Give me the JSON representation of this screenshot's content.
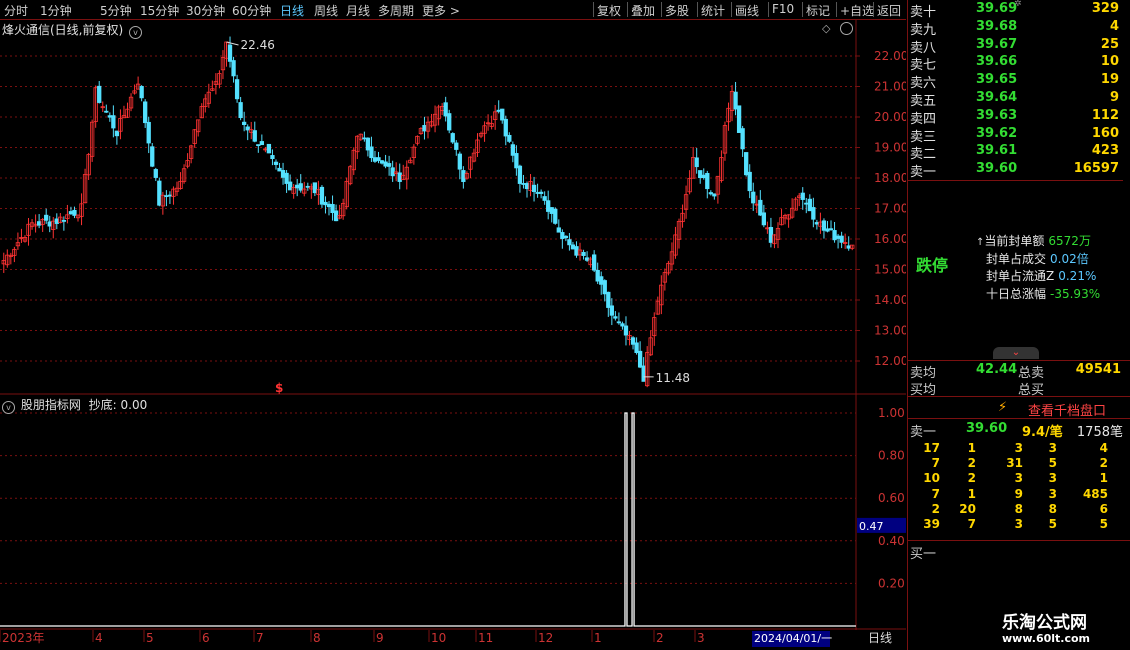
{
  "toolbar": {
    "periods": [
      {
        "label": "分时",
        "active": false
      },
      {
        "label": "1分钟",
        "active": false
      },
      {
        "label": "5分钟",
        "active": false
      },
      {
        "label": "15分钟",
        "active": false
      },
      {
        "label": "30分钟",
        "active": false
      },
      {
        "label": "60分钟",
        "active": false
      },
      {
        "label": "日线",
        "active": true
      },
      {
        "label": "周线",
        "active": false
      },
      {
        "label": "月线",
        "active": false
      },
      {
        "label": "多周期",
        "active": false
      },
      {
        "label": "更多",
        "active": false
      }
    ],
    "tools": [
      "复权",
      "叠加",
      "多股",
      "统计",
      "画线",
      "F10",
      "标记",
      "+自选",
      "返回"
    ]
  },
  "main_chart": {
    "title": "烽火通信(日线,前复权)",
    "high_label": "22.46",
    "low_label": "11.48",
    "signal_glyph": "$",
    "colors": {
      "up": "#ff3333",
      "down": "#54e1ff",
      "grid": "#7a1010"
    }
  },
  "indicator": {
    "title": "股朋指标网",
    "value_text": "抄底: 0.00",
    "cursor_value": "0.47"
  },
  "x_axis": {
    "labels": [
      "2023年",
      "4",
      "5",
      "6",
      "7",
      "8",
      "9",
      "10",
      "11",
      "12",
      "1",
      "2",
      "3"
    ],
    "cursor_date": "2024/04/01/一",
    "period_label": "日线"
  },
  "chart_data": [
    {
      "type": "candlestick",
      "y_axis_ticks": [
        "22.00",
        "21.00",
        "20.00",
        "19.00",
        "18.00",
        "17.00",
        "16.00",
        "15.00",
        "14.00",
        "13.00",
        "12.00"
      ],
      "ylim": [
        11.2,
        22.6
      ],
      "anchors": [
        [
          0,
          15.3
        ],
        [
          8,
          16.5
        ],
        [
          15,
          16.6
        ],
        [
          22,
          17.0
        ],
        [
          26,
          20.8
        ],
        [
          32,
          19.5
        ],
        [
          38,
          21.2
        ],
        [
          44,
          17.2
        ],
        [
          50,
          17.8
        ],
        [
          56,
          20.5
        ],
        [
          60,
          21.0
        ],
        [
          63,
          22.46
        ],
        [
          67,
          20.0
        ],
        [
          73,
          19.0
        ],
        [
          80,
          17.8
        ],
        [
          88,
          17.6
        ],
        [
          95,
          16.6
        ],
        [
          100,
          19.5
        ],
        [
          106,
          18.5
        ],
        [
          112,
          18.0
        ],
        [
          118,
          19.5
        ],
        [
          124,
          20.5
        ],
        [
          130,
          18.0
        ],
        [
          135,
          19.6
        ],
        [
          140,
          20.2
        ],
        [
          146,
          17.9
        ],
        [
          152,
          17.6
        ],
        [
          158,
          16.0
        ],
        [
          166,
          15.2
        ],
        [
          172,
          13.5
        ],
        [
          178,
          12.5
        ],
        [
          181,
          11.48
        ],
        [
          185,
          14.0
        ],
        [
          190,
          16.0
        ],
        [
          195,
          18.5
        ],
        [
          201,
          17.4
        ],
        [
          206,
          21.0
        ],
        [
          211,
          17.5
        ],
        [
          217,
          16.0
        ],
        [
          225,
          17.5
        ],
        [
          232,
          16.3
        ],
        [
          240,
          15.8
        ]
      ],
      "max_label": "22.46",
      "min_label": "11.48"
    },
    {
      "type": "line",
      "title": "股朋指标网",
      "series": [
        {
          "values_note": "",
          "spike_at_bars": [
            176,
            178
          ],
          "baseline": 0.0,
          "peak": 1.0
        }
      ],
      "y_axis_ticks": [
        "1.00",
        "0.80",
        "0.60",
        "0.40",
        "0.20"
      ],
      "ylim": [
        0,
        1.05
      ]
    }
  ],
  "orderbook": {
    "asks": [
      {
        "label": "卖十",
        "price": "39.69",
        "vol": "329"
      },
      {
        "label": "卖九",
        "price": "39.68",
        "vol": "4"
      },
      {
        "label": "卖八",
        "price": "39.67",
        "vol": "25"
      },
      {
        "label": "卖七",
        "price": "39.66",
        "vol": "10"
      },
      {
        "label": "卖六",
        "price": "39.65",
        "vol": "19"
      },
      {
        "label": "卖五",
        "price": "39.64",
        "vol": "9"
      },
      {
        "label": "卖四",
        "price": "39.63",
        "vol": "112"
      },
      {
        "label": "卖三",
        "price": "39.62",
        "vol": "160"
      },
      {
        "label": "卖二",
        "price": "39.61",
        "vol": "423"
      },
      {
        "label": "卖一",
        "price": "39.60",
        "vol": "16597"
      }
    ],
    "limit_status": "跌停",
    "seal_info": [
      {
        "k": "当前封单额",
        "v": "6572万",
        "vcolor": "#33dd33"
      },
      {
        "k": "封单占成交",
        "v": "0.02倍",
        "vcolor": "#5cc8ff"
      },
      {
        "k": "封单占流通Z",
        "v": "0.21%",
        "vcolor": "#5cc8ff"
      },
      {
        "k": "十日总涨幅",
        "v": "-35.93%",
        "vcolor": "#33dd33"
      }
    ],
    "avg_ask_label": "卖均",
    "avg_ask_value": "42.44",
    "total_ask_label": "总卖",
    "total_ask_value": "49541",
    "avg_bid_label": "买均",
    "total_bid_label": "总买",
    "thousand_levels_label": "查看千档盘口",
    "ask1_label": "卖一",
    "ask1_price": "39.60",
    "per_order": "9.4/笔",
    "order_count": "1758笔",
    "queue": [
      [
        "17",
        "1",
        "3",
        "3",
        "4"
      ],
      [
        "7",
        "2",
        "31",
        "5",
        "2"
      ],
      [
        "10",
        "2",
        "3",
        "3",
        "1"
      ],
      [
        "7",
        "1",
        "9",
        "3",
        "485"
      ],
      [
        "2",
        "20",
        "8",
        "8",
        "6"
      ],
      [
        "39",
        "7",
        "3",
        "5",
        "5"
      ]
    ],
    "bid1_label": "买一"
  },
  "watermark": {
    "brand": "乐淘公式网",
    "url": "www.60lt.com"
  }
}
